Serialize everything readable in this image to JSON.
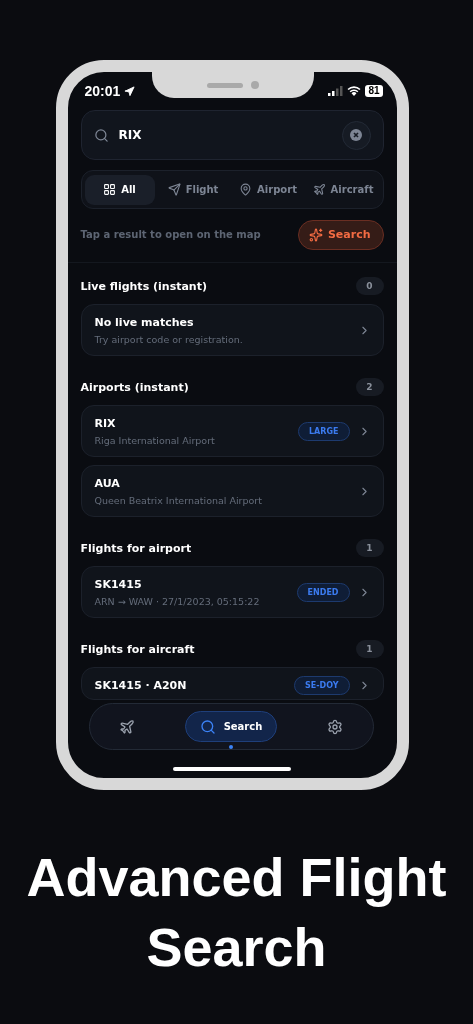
{
  "status_bar": {
    "time": "20:01",
    "battery": "81"
  },
  "search": {
    "value": "RIX"
  },
  "filters": [
    {
      "kind": "all",
      "label": "All",
      "selected": true
    },
    {
      "kind": "flight",
      "label": "Flight",
      "selected": false
    },
    {
      "kind": "airport",
      "label": "Airport",
      "selected": false
    },
    {
      "kind": "aircraft",
      "label": "Aircraft",
      "selected": false
    }
  ],
  "hint": "Tap a result to open on the map",
  "search_button": "Search",
  "sections": [
    {
      "title": "Live flights (instant)",
      "count": "0",
      "items": [
        {
          "title": "No live matches",
          "subtitle": "Try airport code or registration."
        }
      ]
    },
    {
      "title": "Airports (instant)",
      "count": "2",
      "items": [
        {
          "title": "RIX",
          "subtitle": "Riga International Airport",
          "badge": "LARGE"
        },
        {
          "title": "AUA",
          "subtitle": "Queen Beatrix International Airport"
        }
      ]
    },
    {
      "title": "Flights for airport",
      "count": "1",
      "items": [
        {
          "title": "SK1415",
          "subtitle": "ARN → WAW · 27/1/2023, 05:15:22",
          "badge": "ENDED"
        }
      ]
    },
    {
      "title": "Flights for aircraft",
      "count": "1",
      "items": [
        {
          "title": "SK1415 · A20N",
          "badge": "SE-DOY"
        }
      ]
    }
  ],
  "nav": [
    {
      "kind": "flights",
      "selected": false
    },
    {
      "kind": "search",
      "label": "Search",
      "selected": true
    },
    {
      "kind": "settings",
      "selected": false
    }
  ],
  "headline": "Advanced Flight Search"
}
